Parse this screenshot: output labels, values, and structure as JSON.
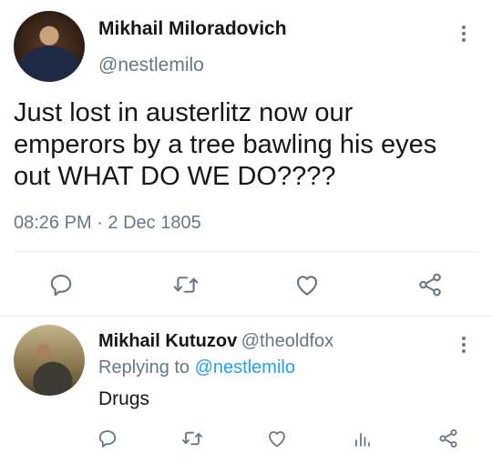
{
  "tweet": {
    "author_name": "Mikhail Miloradovich",
    "author_handle": "@nestlemilo",
    "text_lines": [
      "Just lost in austerlitz now our",
      "emperors by a tree bawling his eyes",
      "out WHAT DO WE DO????"
    ],
    "time": "08:26 PM",
    "separator": "·",
    "date": "2 Dec 1805",
    "icons": [
      "reply-icon",
      "retweet-icon",
      "like-icon",
      "share-icon"
    ]
  },
  "reply": {
    "author_name": "Mikhail Kutuzov",
    "author_handle": "@theoldfox",
    "replying_prefix": "Replying to",
    "replying_handle": "@nestlemilo",
    "text": "Drugs",
    "icons": [
      "reply-icon",
      "retweet-icon",
      "like-icon",
      "analytics-icon",
      "share-icon"
    ]
  },
  "colors": {
    "text": "#14171a",
    "secondary": "#657786",
    "accent": "#1da1f2",
    "divider": "#e6ecf0"
  }
}
